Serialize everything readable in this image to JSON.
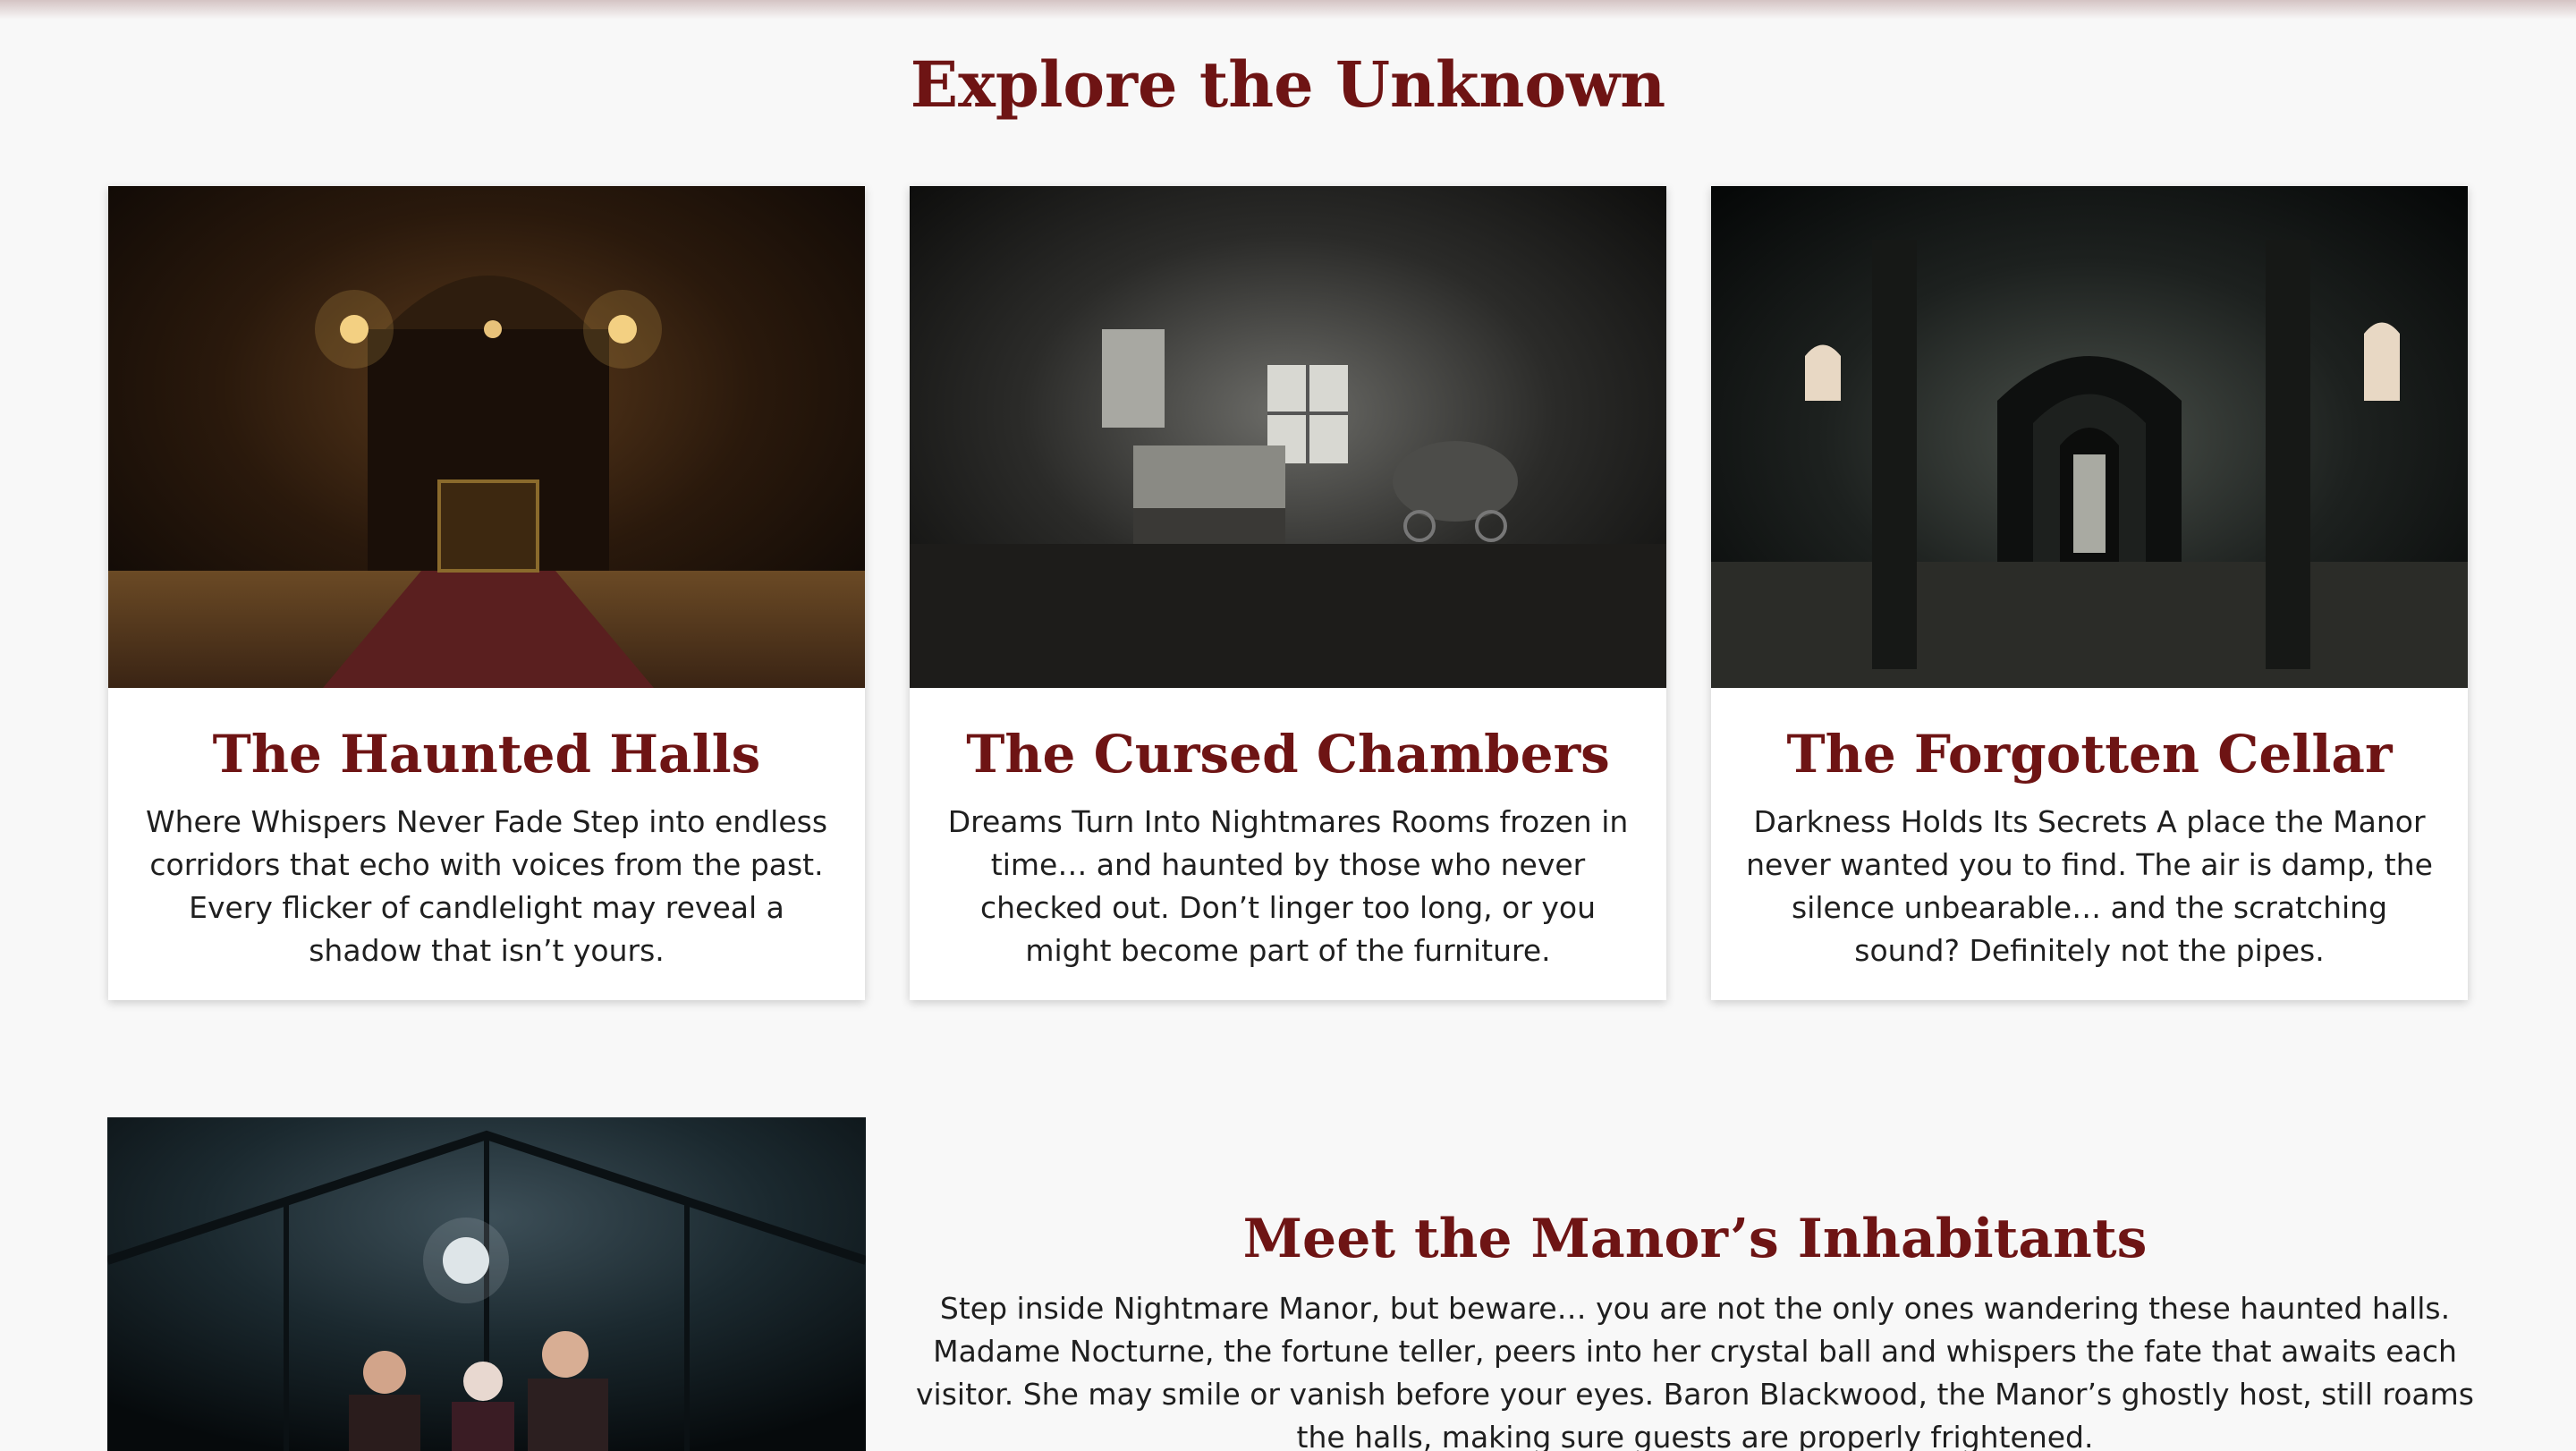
{
  "explore": {
    "title": "Explore the Unknown",
    "cards": [
      {
        "title": "The Haunted Halls",
        "text": "Where Whispers Never Fade Step into endless corridors that echo with voices from the past. Every flicker of candlelight may reveal a shadow that isn’t yours."
      },
      {
        "title": "The Cursed Chambers",
        "text": "Dreams Turn Into Nightmares Rooms frozen in time… and haunted by those who never checked out. Don’t linger too long, or you might become part of the furniture."
      },
      {
        "title": "The Forgotten Cellar",
        "text": "Darkness Holds Its Secrets A place the Manor never wanted you to find. The air is damp, the silence unbearable… and the scratching sound? Definitely not the pipes."
      }
    ]
  },
  "inhabitants": {
    "title": "Meet the Manor’s Inhabitants",
    "text": "Step inside Nightmare Manor, but beware… you are not the only ones wandering these haunted halls. Madame Nocturne, the fortune teller, peers into her crystal ball and whispers the fate that awaits each visitor. She may smile or vanish before your eyes. Baron Blackwood, the Manor’s ghostly host, still roams the halls, making sure guests are properly frightened."
  },
  "colors": {
    "accent": "#6e1414",
    "background": "#f8f8f8",
    "card": "#ffffff"
  }
}
